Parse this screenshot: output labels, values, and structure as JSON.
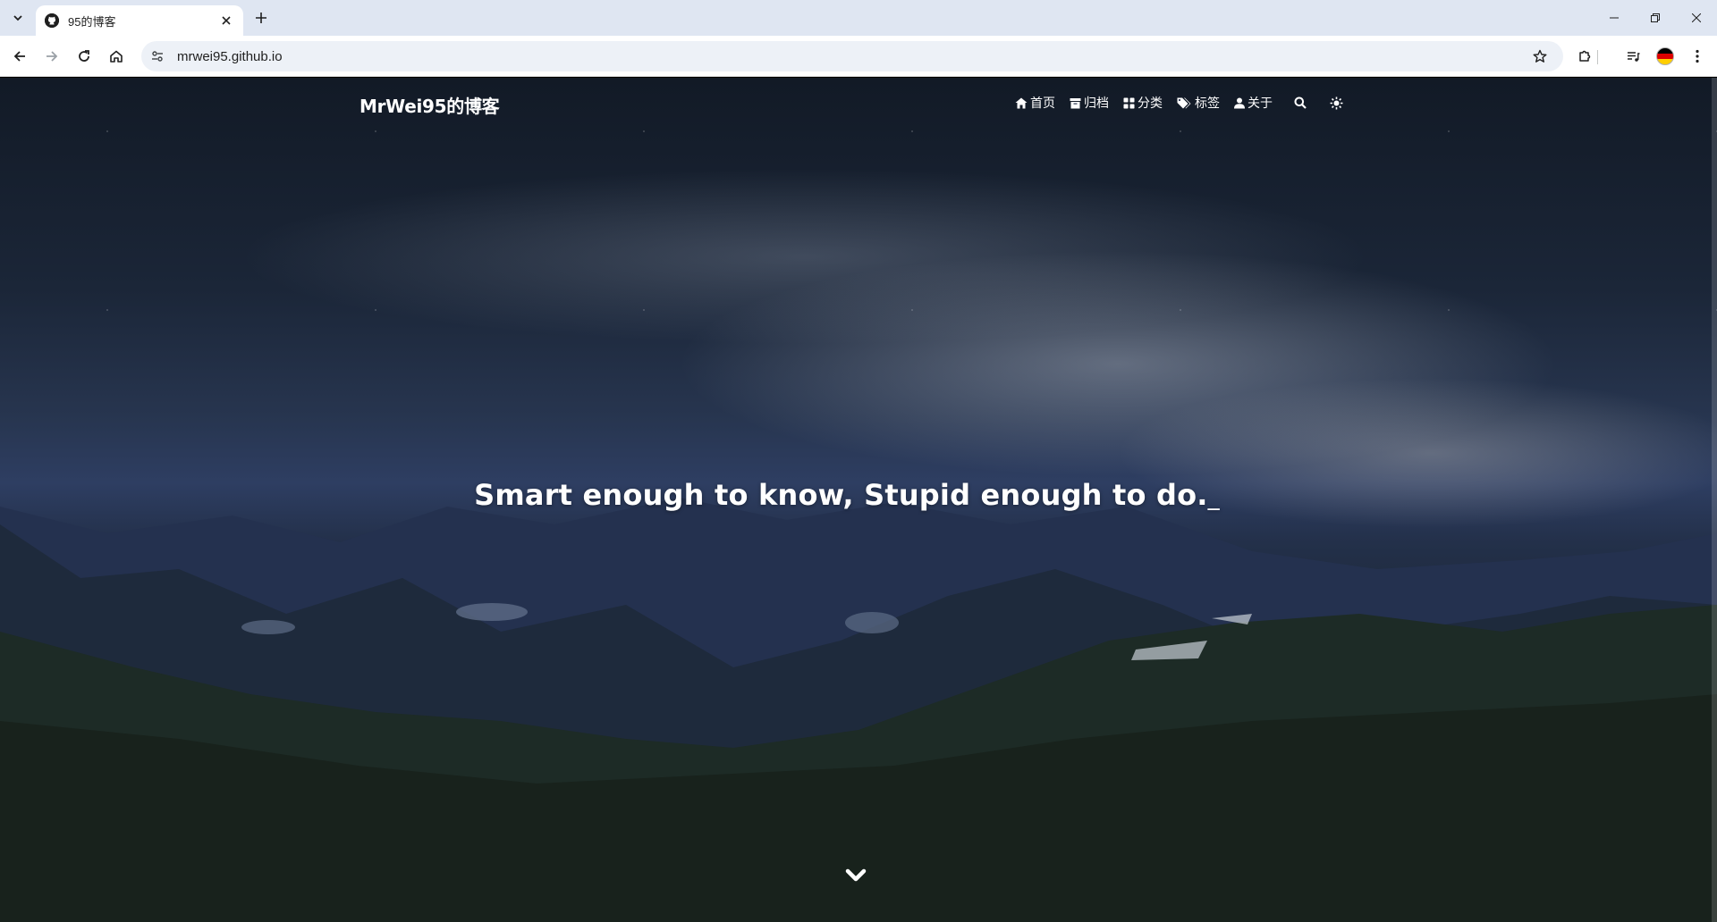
{
  "browser": {
    "tab": {
      "title": "95的博客",
      "favicon_icon": "github-icon"
    },
    "url": "mrwei95.github.io",
    "profile_colors": [
      "#000000",
      "#dd0000",
      "#ffce00"
    ]
  },
  "site": {
    "title": "MrWei95的博客",
    "nav": [
      {
        "icon": "home-icon",
        "label": "首页"
      },
      {
        "icon": "archive-icon",
        "label": "归档"
      },
      {
        "icon": "grid-icon",
        "label": "分类"
      },
      {
        "icon": "tags-icon",
        "label": "标签"
      },
      {
        "icon": "user-icon",
        "label": "关于"
      }
    ],
    "search_icon": "search-icon",
    "theme_icon": "sun-icon"
  },
  "hero": {
    "tagline": "Smart enough to know, Stupid enough to do.",
    "cursor": "_",
    "scroll_icon": "chevron-down-icon"
  }
}
